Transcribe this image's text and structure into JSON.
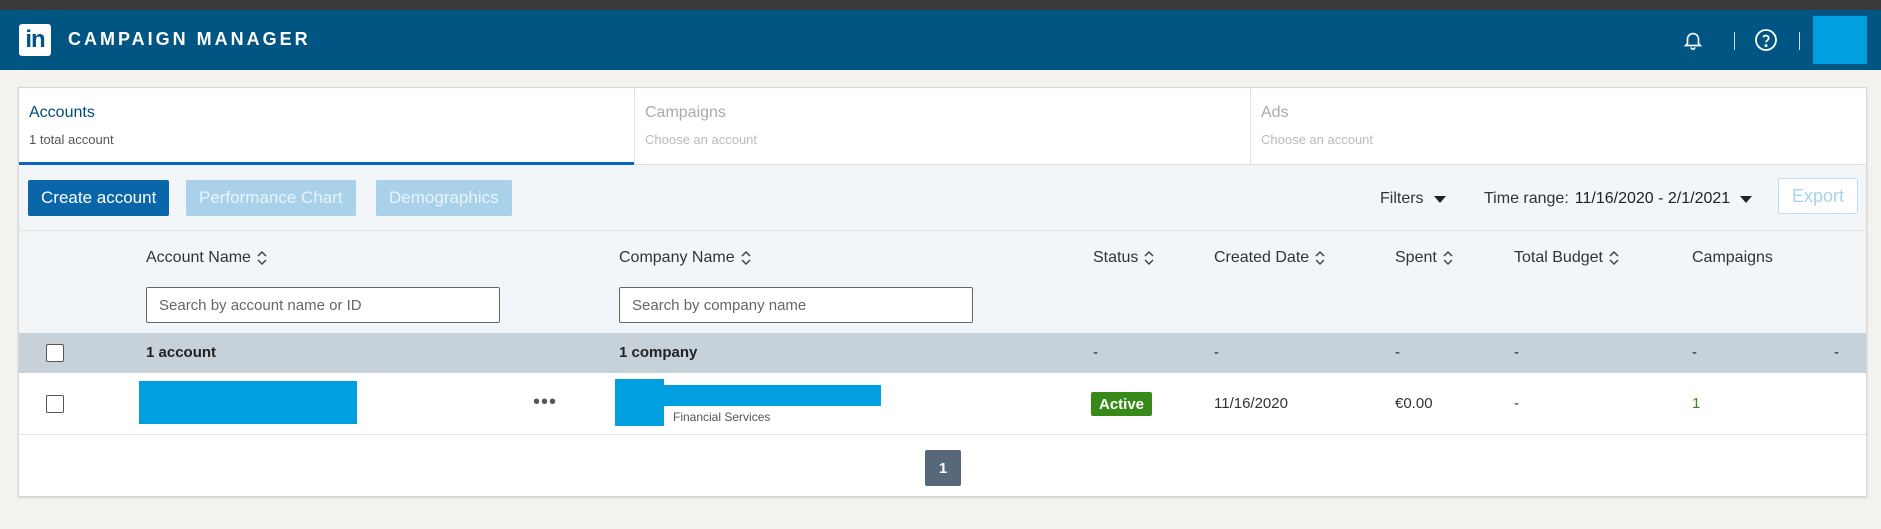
{
  "header": {
    "logo": "in",
    "title": "CAMPAIGN MANAGER",
    "icons": [
      "bell-icon",
      "help-icon"
    ]
  },
  "tabs": [
    {
      "title": "Accounts",
      "subtitle": "1 total account",
      "active": true
    },
    {
      "title": "Campaigns",
      "subtitle": "Choose an account",
      "active": false
    },
    {
      "title": "Ads",
      "subtitle": "Choose an account",
      "active": false
    }
  ],
  "toolbar": {
    "create_account": "Create account",
    "performance_chart": "Performance Chart",
    "demographics": "Demographics",
    "filters": "Filters",
    "time_range_label": "Time range:",
    "time_range_value": "11/16/2020 - 2/1/2021",
    "export": "Export"
  },
  "table": {
    "columns": {
      "account_name": "Account Name",
      "company_name": "Company Name",
      "status": "Status",
      "created_date": "Created Date",
      "spent": "Spent",
      "total_budget": "Total Budget",
      "campaigns": "Campaigns"
    },
    "search": {
      "account_placeholder": "Search by account name or ID",
      "company_placeholder": "Search by company name"
    },
    "summary": {
      "accounts": "1 account",
      "companies": "1 company",
      "status": "-",
      "created_date": "-",
      "spent": "-",
      "total_budget": "-",
      "campaigns": "-",
      "extra": "-"
    },
    "rows": [
      {
        "more": "•••",
        "industry": "Financial Services",
        "status": "Active",
        "created_date": "11/16/2020",
        "spent": "€0.00",
        "total_budget": "-",
        "campaigns": "1"
      }
    ]
  },
  "pagination": {
    "current": "1"
  },
  "colors": {
    "header_bg": "#005582",
    "primary": "#0a66a8",
    "active_status": "#378a1a",
    "redaction": "#00a0e0"
  }
}
